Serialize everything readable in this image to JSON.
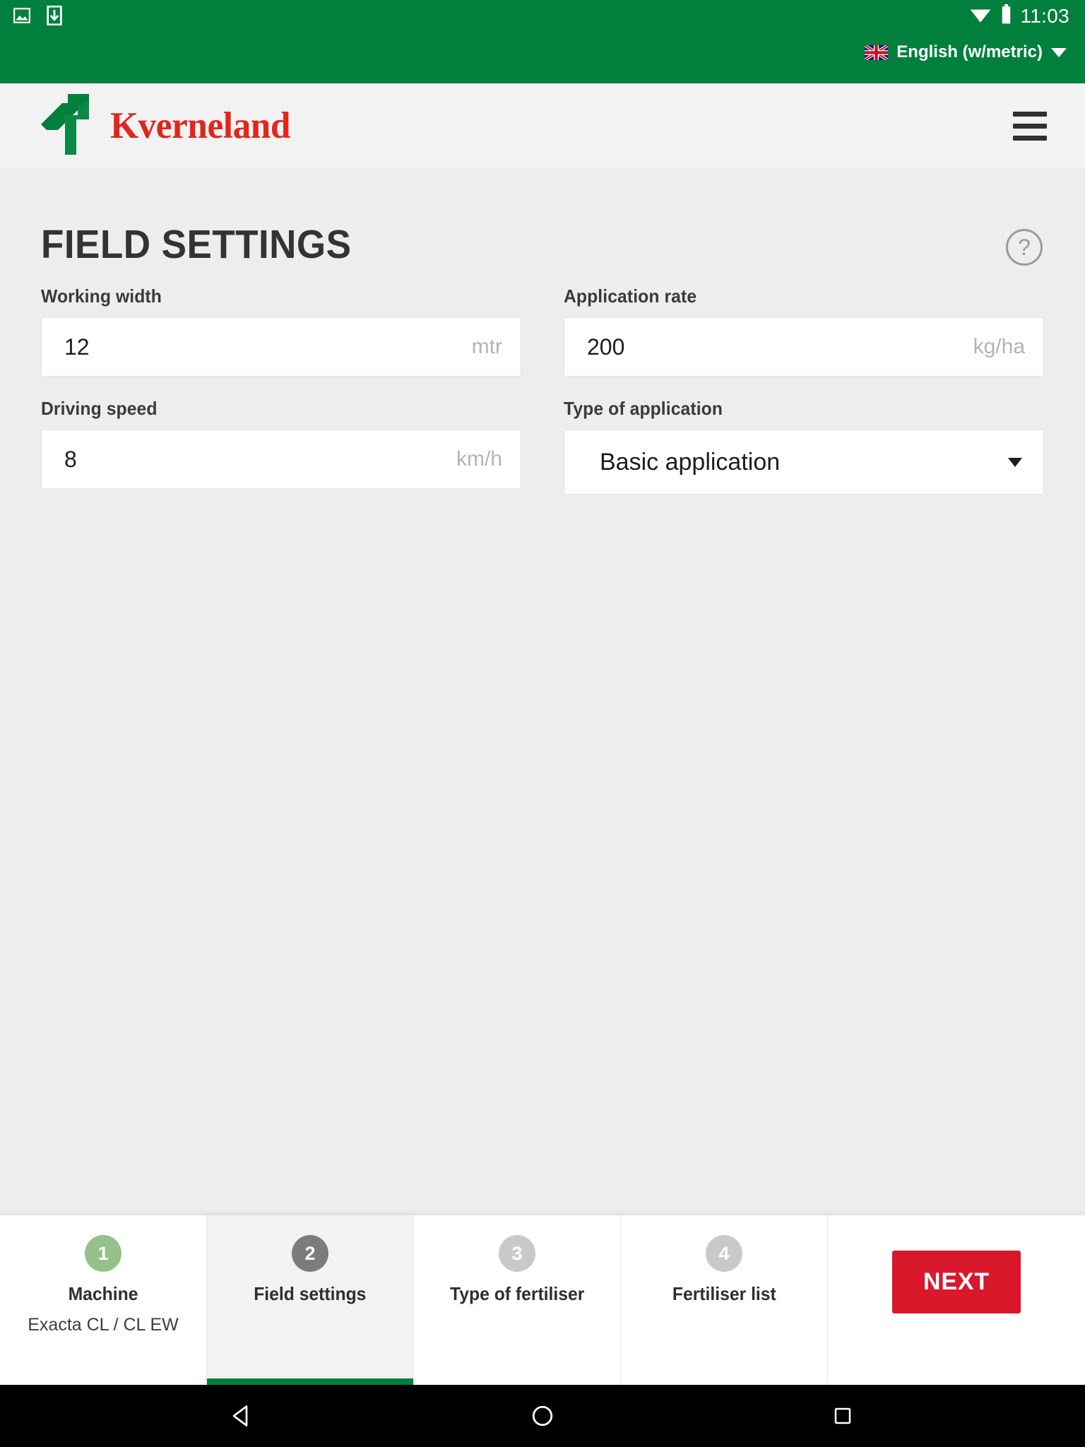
{
  "statusbar": {
    "icons": [
      "image-icon",
      "download-icon"
    ],
    "wifi_icon": "wifi-icon",
    "battery_icon": "battery-icon",
    "clock": "11:03"
  },
  "language_selector": {
    "flag_icon": "uk-flag-icon",
    "label": "English (w/metric)",
    "caret_icon": "chevron-down-icon"
  },
  "appbar": {
    "brand": "Kverneland",
    "logo_icon": "kverneland-arrow-logo",
    "menu_icon": "hamburger-menu-icon"
  },
  "page": {
    "title": "FIELD SETTINGS",
    "help_label": "?"
  },
  "form": {
    "fields": [
      {
        "name": "working-width",
        "label": "Working width",
        "value": "12",
        "unit": "mtr",
        "type": "text"
      },
      {
        "name": "application-rate",
        "label": "Application rate",
        "value": "200",
        "unit": "kg/ha",
        "type": "text"
      },
      {
        "name": "driving-speed",
        "label": "Driving speed",
        "value": "8",
        "unit": "km/h",
        "type": "text"
      },
      {
        "name": "type-of-application",
        "label": "Type of application",
        "value": "Basic application",
        "unit": "",
        "type": "select"
      }
    ]
  },
  "wizard": {
    "steps": [
      {
        "number": "1",
        "label": "Machine",
        "sub": "Exacta CL / CL EW",
        "state": "done"
      },
      {
        "number": "2",
        "label": "Field settings",
        "sub": "",
        "state": "current"
      },
      {
        "number": "3",
        "label": "Type of fertiliser",
        "sub": "",
        "state": "todo"
      },
      {
        "number": "4",
        "label": "Fertiliser list",
        "sub": "",
        "state": "todo"
      }
    ],
    "next_label": "NEXT"
  },
  "navbar": {
    "back_icon": "back-triangle-icon",
    "home_icon": "home-circle-icon",
    "recents_icon": "recents-square-icon"
  },
  "colors": {
    "brand_green": "#00803c",
    "brand_red": "#e1261c",
    "next_red": "#d9182c",
    "step_done": "#96c08a",
    "step_current": "#7c7c7c",
    "step_todo": "#c9c9c9"
  }
}
